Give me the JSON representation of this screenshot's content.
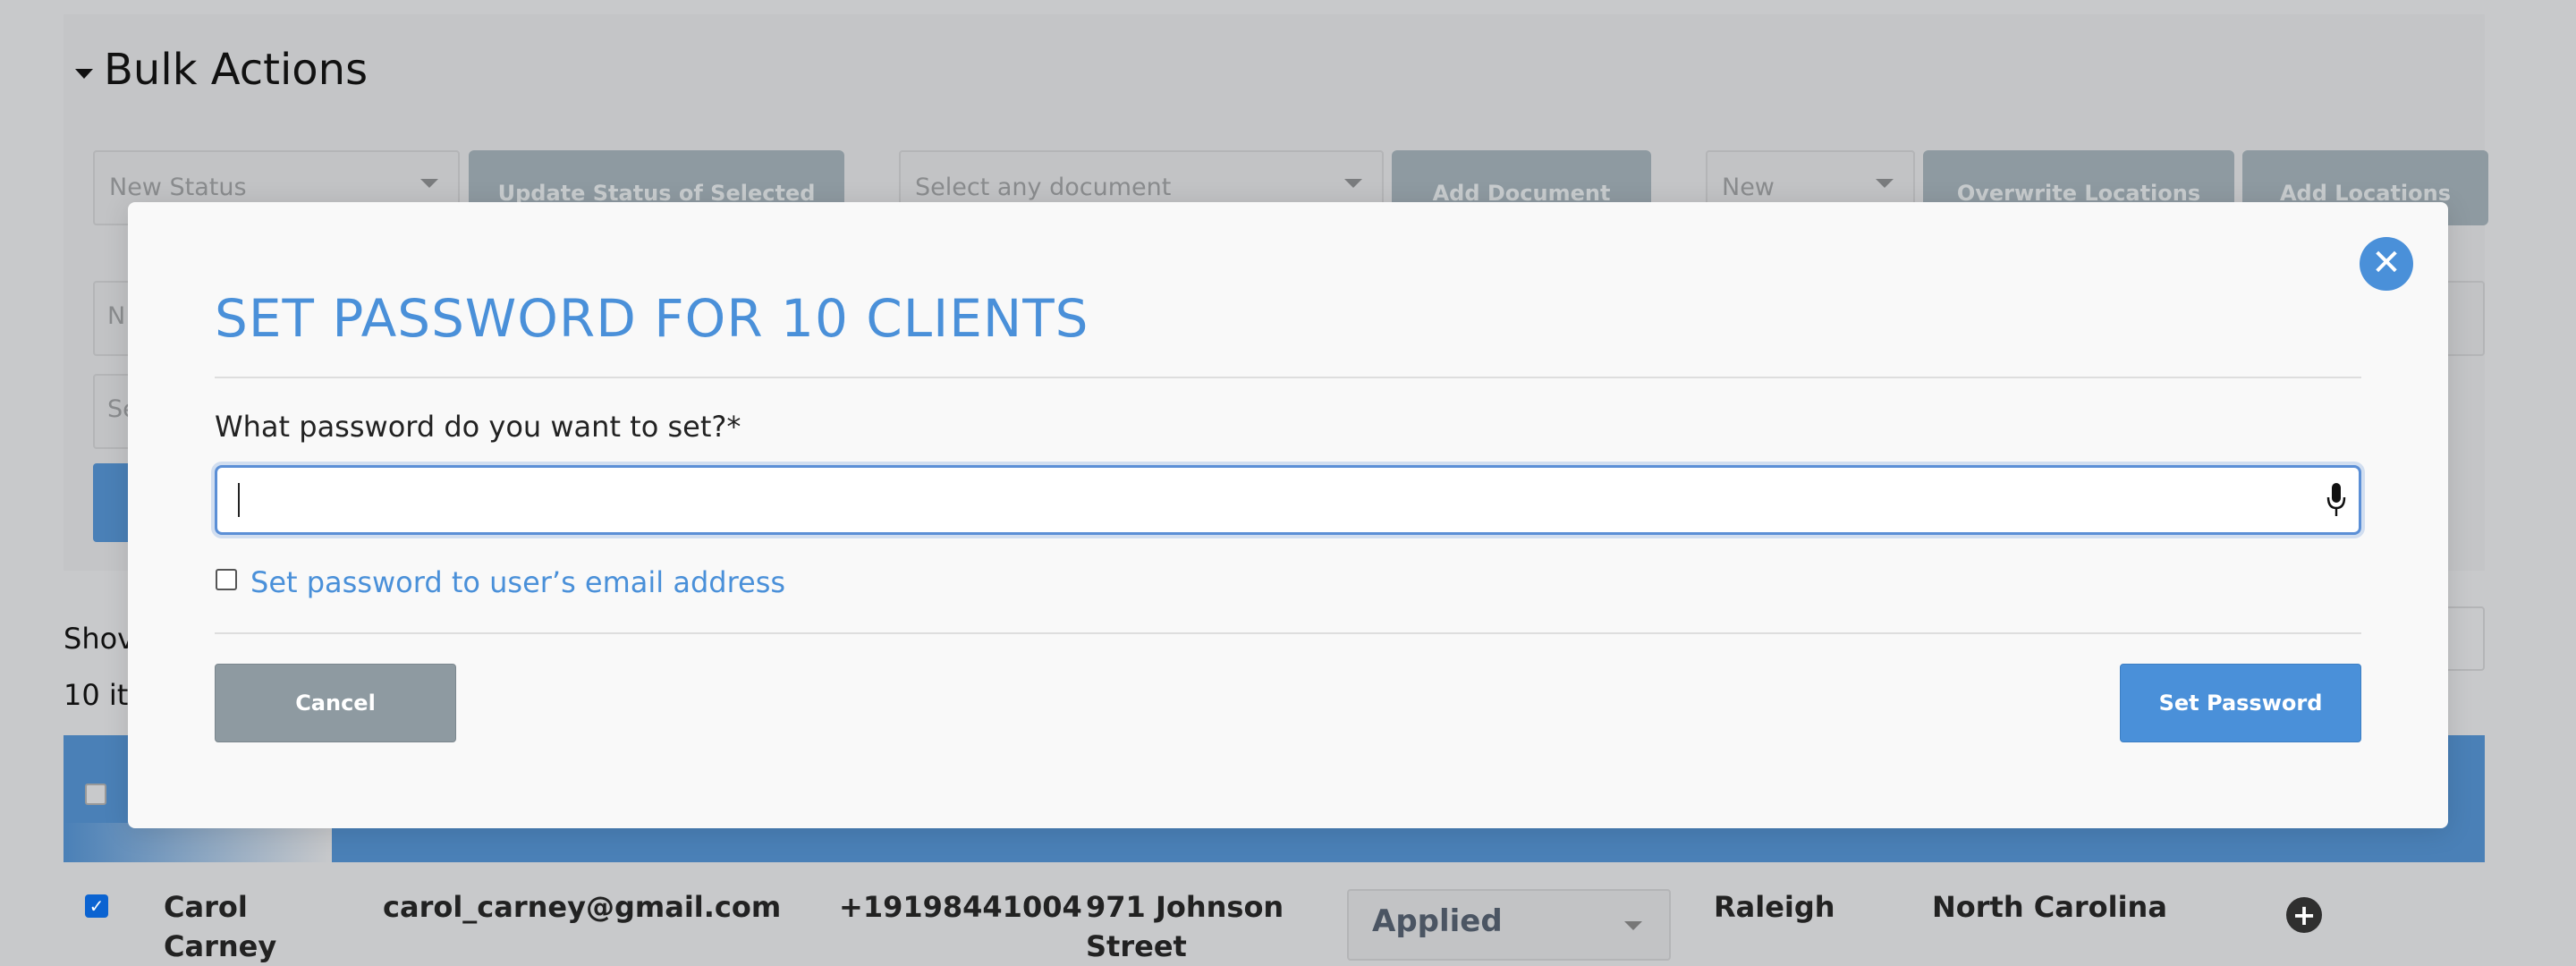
{
  "bulk": {
    "title": "Bulk Actions",
    "status_select": "New Status",
    "update_status_button": "Update Status of Selected",
    "document_select": "Select any document",
    "add_document_button": "Add Document",
    "location_select": "New",
    "overwrite_locations_button": "Overwrite Locations",
    "add_locations_button": "Add Locations",
    "partial_field_1": "N",
    "partial_field_2": "Se"
  },
  "list": {
    "showing_partial": "Shov",
    "items_partial": "10 ite"
  },
  "row": {
    "name": "Carol Carney",
    "email": "carol_carney@gmail.com",
    "phone": "+19198441004",
    "street": "971 Johnson Street",
    "status": "Applied",
    "city": "Raleigh",
    "state": "North Carolina",
    "checked": true
  },
  "modal": {
    "title": "SET PASSWORD FOR 10 CLIENTS",
    "field_label": "What password do you want to set?*",
    "password_value": "",
    "email_checkbox_label": "Set password to user’s email address",
    "cancel_label": "Cancel",
    "submit_label": "Set Password",
    "close_symbol": "✕"
  },
  "colors": {
    "accent": "#4a90d9",
    "cancel": "#8e9aa1",
    "overlay_bg": "#c8c9cb"
  }
}
